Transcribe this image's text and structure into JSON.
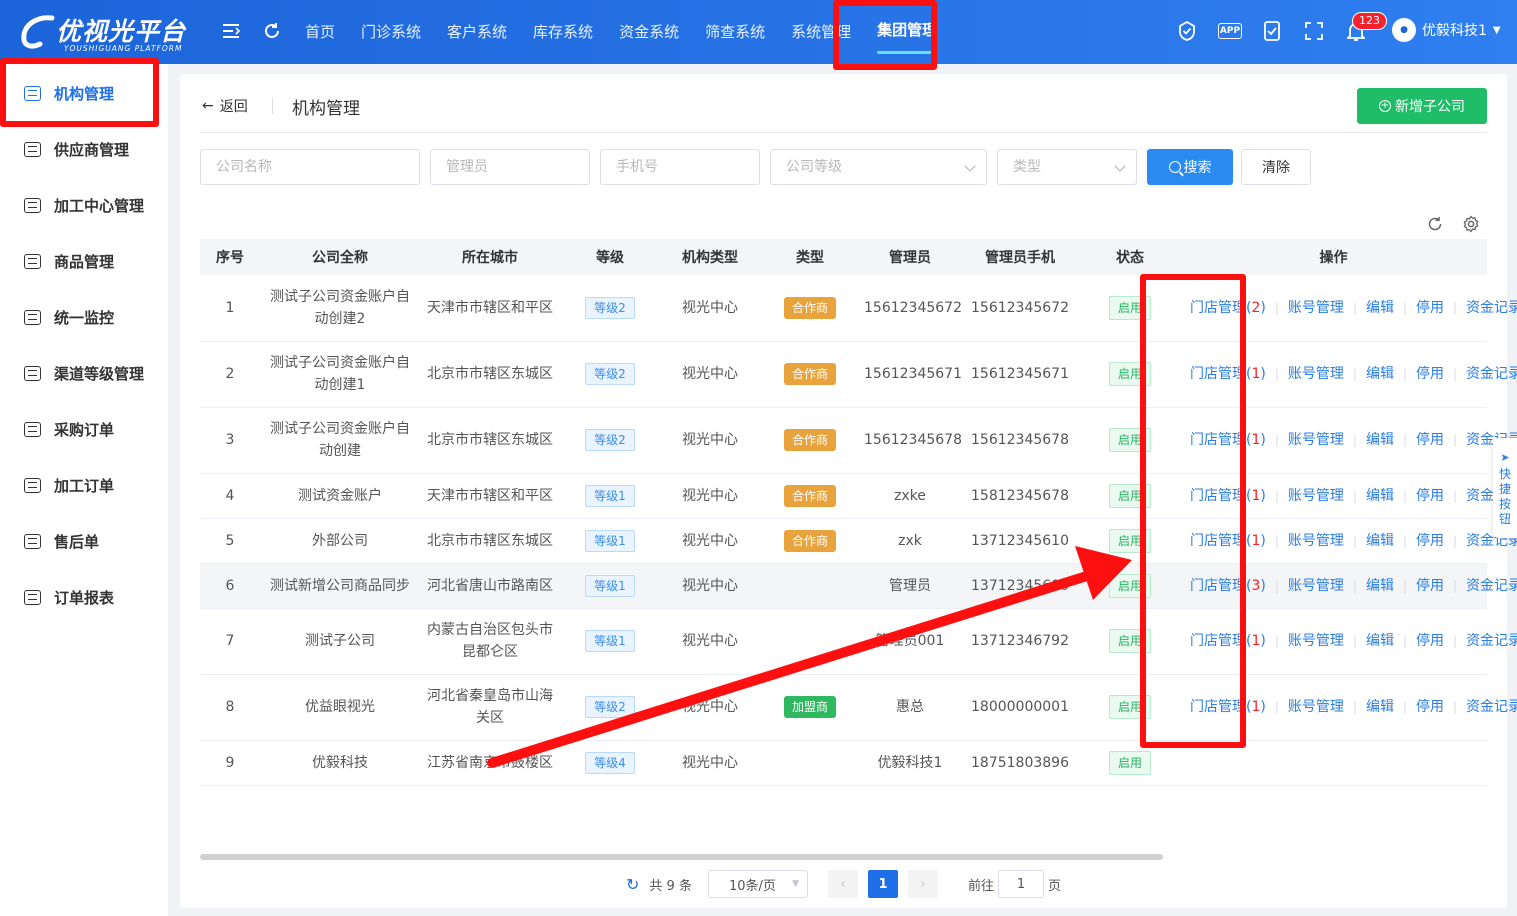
{
  "header": {
    "logo_name": "优视光平台",
    "logo_sub": "YOUSHIGUANG PLATFORM",
    "nav": [
      "首页",
      "门诊系统",
      "客户系统",
      "库存系统",
      "资金系统",
      "筛查系统",
      "系统管理",
      "集团管理"
    ],
    "active_nav": "集团管理",
    "notification_count": "123",
    "user_name": "优毅科技1",
    "app_icon_text": "APP"
  },
  "sidebar": {
    "items": [
      "机构管理",
      "供应商管理",
      "加工中心管理",
      "商品管理",
      "统一监控",
      "渠道等级管理",
      "采购订单",
      "加工订单",
      "售后单",
      "订单报表"
    ],
    "active": "机构管理"
  },
  "main": {
    "back_label": "返回",
    "title": "机构管理",
    "new_button": "新增子公司"
  },
  "filters": {
    "company_name": "公司名称",
    "admin": "管理员",
    "phone": "手机号",
    "company_grade": "公司等级",
    "type": "类型",
    "search_button": "搜索",
    "clear_button": "清除"
  },
  "table": {
    "columns": [
      "序号",
      "公司全称",
      "所在城市",
      "等级",
      "机构类型",
      "类型",
      "管理员",
      "管理员手机",
      "状态",
      "操作"
    ],
    "rows": [
      {
        "no": "1",
        "name": "测试子公司资金账户自动创建2",
        "city": "天津市市辖区和平区",
        "grade": "等级2",
        "org_type": "视光中心",
        "type": "合作商",
        "admin": "15612345672",
        "phone": "15612345672",
        "status": "启用",
        "store": "门店管理(",
        "store_count": "2",
        "store_end": ")"
      },
      {
        "no": "2",
        "name": "测试子公司资金账户自动创建1",
        "city": "北京市市辖区东城区",
        "grade": "等级2",
        "org_type": "视光中心",
        "type": "合作商",
        "admin": "15612345671",
        "phone": "15612345671",
        "status": "启用",
        "store": "门店管理(",
        "store_count": "1",
        "store_end": ")"
      },
      {
        "no": "3",
        "name": "测试子公司资金账户自动创建",
        "city": "北京市市辖区东城区",
        "grade": "等级2",
        "org_type": "视光中心",
        "type": "合作商",
        "admin": "15612345678",
        "phone": "15612345678",
        "status": "启用",
        "store": "门店管理(",
        "store_count": "1",
        "store_end": ")"
      },
      {
        "no": "4",
        "name": "测试资金账户",
        "city": "天津市市辖区和平区",
        "grade": "等级1",
        "org_type": "视光中心",
        "type": "合作商",
        "admin": "zxke",
        "phone": "15812345678",
        "status": "启用",
        "store": "门店管理(",
        "store_count": "1",
        "store_end": ")"
      },
      {
        "no": "5",
        "name": "外部公司",
        "city": "北京市市辖区东城区",
        "grade": "等级1",
        "org_type": "视光中心",
        "type": "合作商",
        "admin": "zxk",
        "phone": "13712345610",
        "status": "启用",
        "store": "门店管理(",
        "store_count": "1",
        "store_end": ")"
      },
      {
        "no": "6",
        "name": "测试新增公司商品同步",
        "city": "河北省唐山市路南区",
        "grade": "等级1",
        "org_type": "视光中心",
        "type": "",
        "admin": "管理员",
        "phone": "13712345600",
        "status": "启用",
        "store": "门店管理(",
        "store_count": "3",
        "store_end": ")"
      },
      {
        "no": "7",
        "name": "测试子公司",
        "city": "内蒙古自治区包头市昆都仑区",
        "grade": "等级1",
        "org_type": "视光中心",
        "type": "",
        "admin": "管理员001",
        "phone": "13712346792",
        "status": "启用",
        "store": "门店管理(",
        "store_count": "1",
        "store_end": ")"
      },
      {
        "no": "8",
        "name": "优益眼视光",
        "city": "河北省秦皇岛市山海关区",
        "grade": "等级2",
        "org_type": "视光中心",
        "type": "加盟商",
        "admin": "惠总",
        "phone": "18000000001",
        "status": "启用",
        "store": "门店管理(",
        "store_count": "1",
        "store_end": ")"
      },
      {
        "no": "9",
        "name": "优毅科技",
        "city": "江苏省南京市鼓楼区",
        "grade": "等级4",
        "org_type": "视光中心",
        "type": "",
        "admin": "优毅科技1",
        "phone": "18751803896",
        "status": "启用",
        "store": "",
        "store_count": "",
        "store_end": ""
      }
    ],
    "row_actions": [
      "账号管理",
      "编辑",
      "停用",
      "资金记录"
    ]
  },
  "pagination": {
    "total": "共 9 条",
    "page_size": "10条/页",
    "current": "1",
    "goto_label": "前往",
    "goto_value": "1",
    "page_unit": "页"
  },
  "quick_button": "快捷按钮",
  "colors": {
    "brand": "#1e6fe8",
    "partner": "#e8a33c",
    "franchise": "#2fb85f",
    "annotation": "#ff1010"
  }
}
